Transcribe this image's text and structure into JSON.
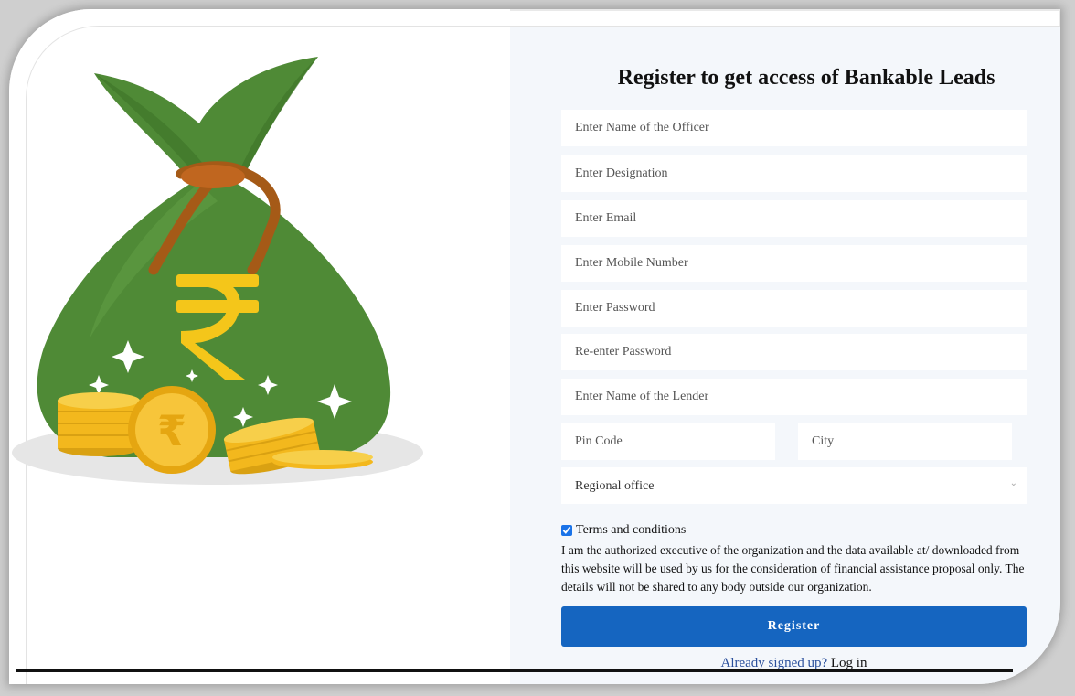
{
  "form": {
    "title": "Register to get access of Bankable Leads",
    "placeholders": {
      "officer_name": "Enter Name of the Officer",
      "designation": "Enter Designation",
      "email": "Enter Email",
      "mobile": "Enter Mobile Number",
      "password": "Enter Password",
      "reenter_password": "Re-enter Password",
      "lender_name": "Enter Name of the Lender",
      "pin_code": "Pin Code",
      "city": "City"
    },
    "regional_office": {
      "selected": "Regional office"
    },
    "terms": {
      "checked": true,
      "label": "Terms and conditions",
      "text": "I am the authorized executive of the organization and the data available at/ downloaded from this website will be used by us for the consideration of financial assistance proposal only. The details will not be shared to any body outside our organization."
    },
    "register_label": "Register",
    "login_prompt": "Already signed up?",
    "login_label": "Log in"
  },
  "illustration": {
    "icons": [
      "money-bag-icon",
      "rupee-icon",
      "coin-stack-icon",
      "sparkle-icon"
    ]
  },
  "colors": {
    "bag_green": "#4f8a36",
    "rope_brown": "#a55a17",
    "coin_gold": "#f3b81d",
    "rupee_yellow": "#f4c61a",
    "button_blue": "#1565c0",
    "panel_bg": "#f4f7fb"
  }
}
